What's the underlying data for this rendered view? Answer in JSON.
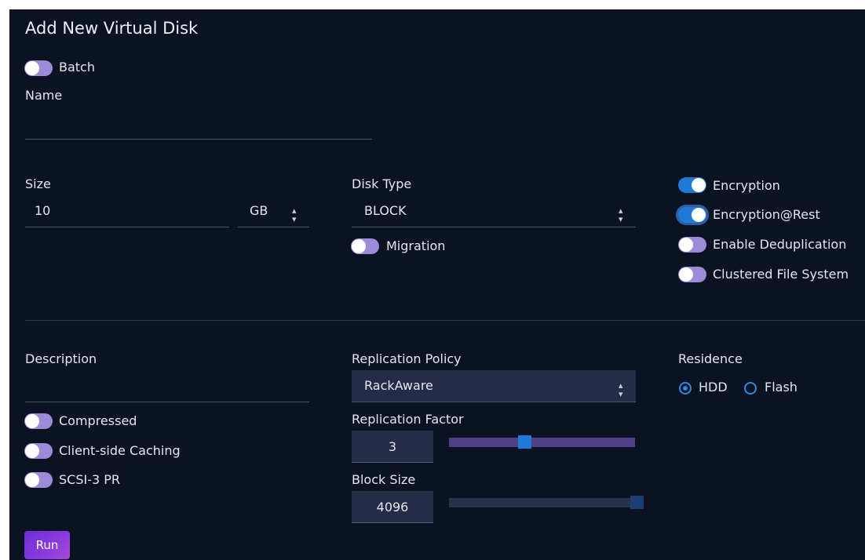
{
  "title": "Add New Virtual Disk",
  "batch": {
    "label": "Batch",
    "on": false
  },
  "name": {
    "label": "Name",
    "value": ""
  },
  "size": {
    "label": "Size",
    "value": "10",
    "unit": "GB"
  },
  "disk_type": {
    "label": "Disk Type",
    "value": "BLOCK"
  },
  "migration": {
    "label": "Migration",
    "on": false
  },
  "encryption": {
    "label": "Encryption",
    "on": true
  },
  "encryption_rest": {
    "label": "Encryption@Rest",
    "on": true
  },
  "dedup": {
    "label": "Enable Deduplication",
    "on": false
  },
  "clustered_fs": {
    "label": "Clustered File System",
    "on": false
  },
  "description": {
    "label": "Description",
    "value": ""
  },
  "compressed": {
    "label": "Compressed",
    "on": false
  },
  "client_caching": {
    "label": "Client-side Caching",
    "on": false
  },
  "scsi": {
    "label": "SCSI-3 PR",
    "on": false
  },
  "replication_policy": {
    "label": "Replication Policy",
    "value": "RackAware"
  },
  "replication_factor": {
    "label": "Replication Factor",
    "value": "3",
    "slider_fraction": 0.4
  },
  "block_size": {
    "label": "Block Size",
    "value": "4096",
    "slider_fraction": 1.0
  },
  "residence": {
    "label": "Residence",
    "options": [
      "HDD",
      "Flash"
    ],
    "selected": "HDD"
  },
  "run_label": "Run",
  "colors": {
    "accent": "#1f7ad6",
    "toggle_off": "#9d8bd9",
    "background": "#0b1221",
    "button": "#8b3be0"
  }
}
